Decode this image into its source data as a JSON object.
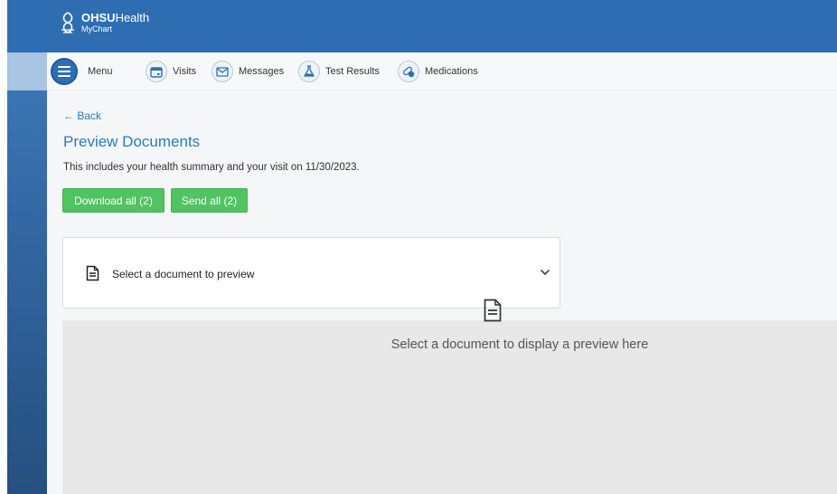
{
  "header": {
    "brand_bold": "OHSU",
    "brand_rest": "Health",
    "brand_sub": "MyChart"
  },
  "nav": {
    "menu": "Menu",
    "visits": "Visits",
    "messages": "Messages",
    "test_results": "Test Results",
    "medications": "Medications"
  },
  "page": {
    "back": "← Back",
    "title": "Preview Documents",
    "subtitle": "This includes your health summary and your visit on 11/30/2023.",
    "download_all": "Download all (2)",
    "send_all": "Send all (2)"
  },
  "select": {
    "label": "Select a document to preview"
  },
  "preview": {
    "message": "Select a document to display a preview here"
  },
  "colors": {
    "header_blue": "#2f6db3",
    "link_blue": "#2a7bbf",
    "button_green": "#4fc461"
  },
  "icons": [
    "hamburger-menu-icon",
    "calendar-icon",
    "envelope-icon",
    "flask-icon",
    "pills-icon",
    "document-icon",
    "chevron-down-icon"
  ]
}
